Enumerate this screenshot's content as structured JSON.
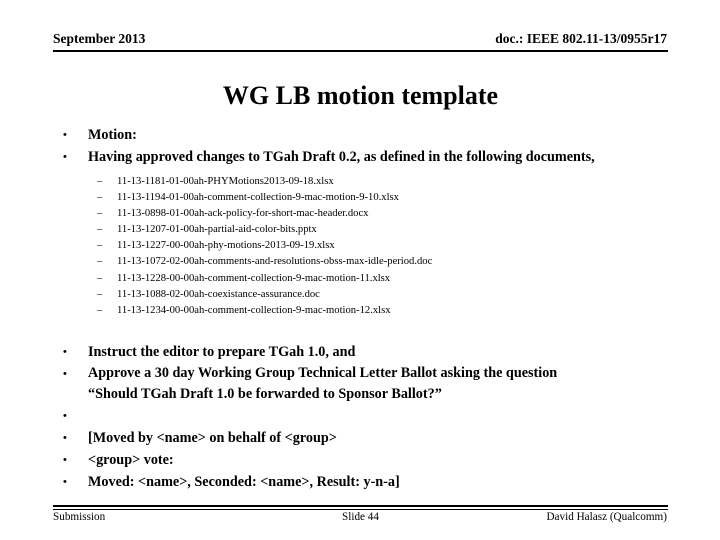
{
  "header": {
    "date": "September 2013",
    "doc": "doc.: IEEE 802.11-13/0955r17"
  },
  "title": "WG LB motion template",
  "bullets": {
    "motion_label": "Motion:",
    "intro": "Having approved changes to TGah Draft 0.2, as defined in the following documents,",
    "documents": [
      "11-13-1181-01-00ah-PHYMotions2013-09-18.xlsx",
      "11-13-1194-01-00ah-comment-collection-9-mac-motion-9-10.xlsx",
      "11-13-0898-01-00ah-ack-policy-for-short-mac-header.docx",
      "11-13-1207-01-00ah-partial-aid-color-bits.pptx",
      "11-13-1227-00-00ah-phy-motions-2013-09-19.xlsx",
      "11-13-1072-02-00ah-comments-and-resolutions-obss-max-idle-period.doc",
      "11-13-1228-00-00ah-comment-collection-9-mac-motion-11.xlsx",
      "11-13-1088-02-00ah-coexistance-assurance.doc",
      "11-13-1234-00-00ah-comment-collection-9-mac-motion-12.xlsx"
    ],
    "instruct_editor": "Instruct the editor to prepare TGah 1.0,  and",
    "approve_ballot_line1": "Approve a 30 day Working Group Technical Letter Ballot asking the question",
    "approve_ballot_line2": "“Should TGah Draft 1.0 be forwarded to Sponsor Ballot?”",
    "blank": "",
    "moved_by": "[Moved by <name> on behalf of <group>",
    "group_vote": "<group> vote:",
    "moved_seconded_result": "Moved: <name>, Seconded: <name>, Result: y-n-a]"
  },
  "markers": {
    "bullet": "•",
    "dash": "–"
  },
  "footer": {
    "left": "Submission",
    "center": "Slide 44",
    "right": "David Halasz (Qualcomm)"
  }
}
